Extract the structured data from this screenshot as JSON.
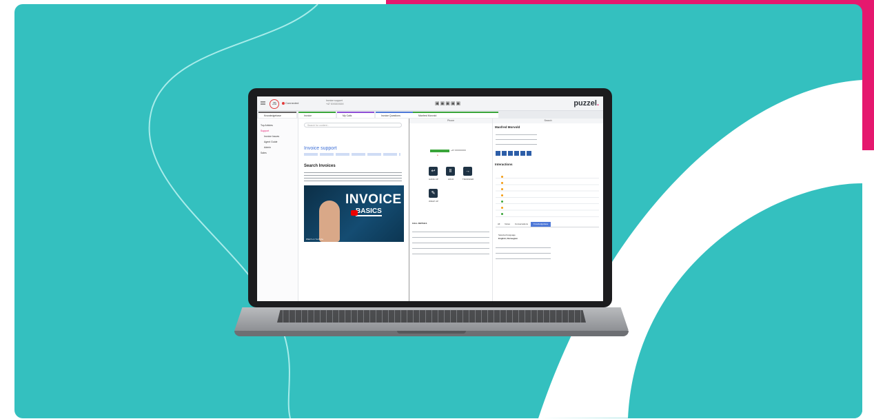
{
  "colors": {
    "teal": "#34c0bf",
    "pink": "#e5186e",
    "white": "#ffffff",
    "accent_blue": "#3d6fd6"
  },
  "topbar": {
    "avatar_initials": "JS",
    "status": "Connected",
    "call_info_line1": "Invoice support",
    "call_info_line2": "+47 XXXXXXXX",
    "logo_main": "puzzel",
    "logo_dot": "."
  },
  "tabs": [
    {
      "label": "Knowledgebase"
    },
    {
      "label": "Invoice"
    },
    {
      "label": "My Calls"
    },
    {
      "label": "Invoice Questions"
    },
    {
      "label": "Manfred Morvold"
    }
  ],
  "kb": {
    "items": [
      "Top Articles",
      "Support",
      "Invoice Issues",
      "Agent Guide",
      "Admin",
      "Sales"
    ]
  },
  "article": {
    "search_placeholder": "Search for content...",
    "title": "Invoice support",
    "heading": "Search Invoices",
    "video_title_big": "INVOICE",
    "video_title_small": "BASICS",
    "video_caption": "Watch on YouTube"
  },
  "phone": {
    "header": "Phone",
    "buttons": [
      "HANG UP",
      "HOLD",
      "TRANSFER",
      "WRAP UP"
    ],
    "call_details_title": "CALL DETAILS",
    "caller_number": "+47 XXXXXXXX"
  },
  "right": {
    "search_header": "Search",
    "contact_section": "Manfred Morvold",
    "interactions_section": "Interactions",
    "subtabs": [
      "All",
      "Notes",
      "Conversations",
      "Knowledgebase"
    ],
    "language_label": "Selected language",
    "language_value": "English, Norwegian"
  }
}
